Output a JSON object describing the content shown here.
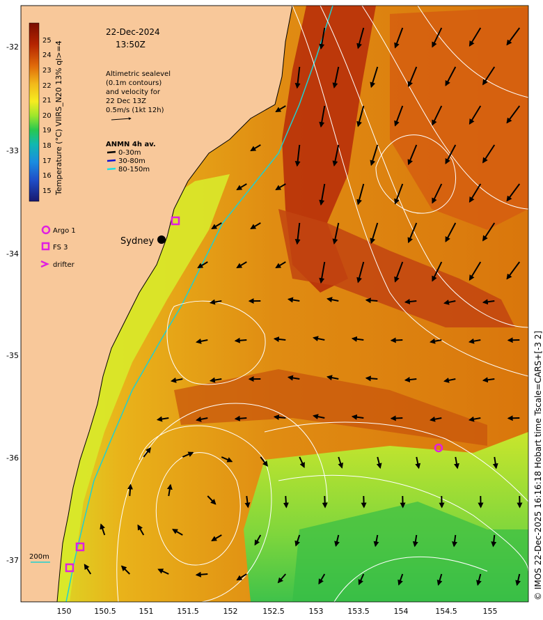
{
  "datetime": {
    "date": "22-Dec-2024",
    "time": "13:50Z"
  },
  "colorbar": {
    "title": "Temperature (°C) VIIRS_N20 13% ql>=4",
    "ticks": [
      "25",
      "24",
      "23",
      "22",
      "21",
      "20",
      "19",
      "18",
      "17",
      "16",
      "15"
    ],
    "colors": [
      "#7a0d00",
      "#b52400",
      "#d9660a",
      "#eeaa10",
      "#f6e21a",
      "#b9ea2c",
      "#3fcf4a",
      "#10b5a6",
      "#1489e0",
      "#1e48c8",
      "#1b1b8a"
    ]
  },
  "altimetry_note": {
    "lines": [
      "Altimetric sealevel",
      "(0.1m contours)",
      "and velocity for",
      "22 Dec 13Z",
      "0.5m/s (1kt 12h)"
    ]
  },
  "anmn": {
    "title": "ANMN 4h av.",
    "items": [
      {
        "label": "0-30m",
        "color": "#000000"
      },
      {
        "label": "30-80m",
        "color": "#1010d0"
      },
      {
        "label": "80-150m",
        "color": "#20e0e0"
      }
    ]
  },
  "platform_legend": [
    {
      "label": "Argo 1",
      "symbol": "circle",
      "color": "#e020e0"
    },
    {
      "label": "FS 3",
      "symbol": "square",
      "color": "#e020e0"
    },
    {
      "label": "drifter",
      "symbol": "chevron",
      "color": "#e020e0"
    }
  ],
  "place_labels": {
    "city": "Sydney",
    "isobath": "200m"
  },
  "axes": {
    "x_ticks": [
      "150",
      "150.5",
      "151",
      "151.5",
      "152",
      "152.5",
      "153",
      "153.5",
      "154",
      "154.5",
      "155"
    ],
    "y_ticks": [
      "-32",
      "-33",
      "-34",
      "-35",
      "-36",
      "-37"
    ]
  },
  "copyright": "© IMOS 22-Dec-2025 16:16:18 Hobart time Tscale=CARS+[-3 2]",
  "colors": {
    "land": "#f8c89a",
    "coastline": "#000000",
    "shelf_break": "#20d0d0",
    "contour": "#ffffff",
    "marker": "#e020e0"
  }
}
